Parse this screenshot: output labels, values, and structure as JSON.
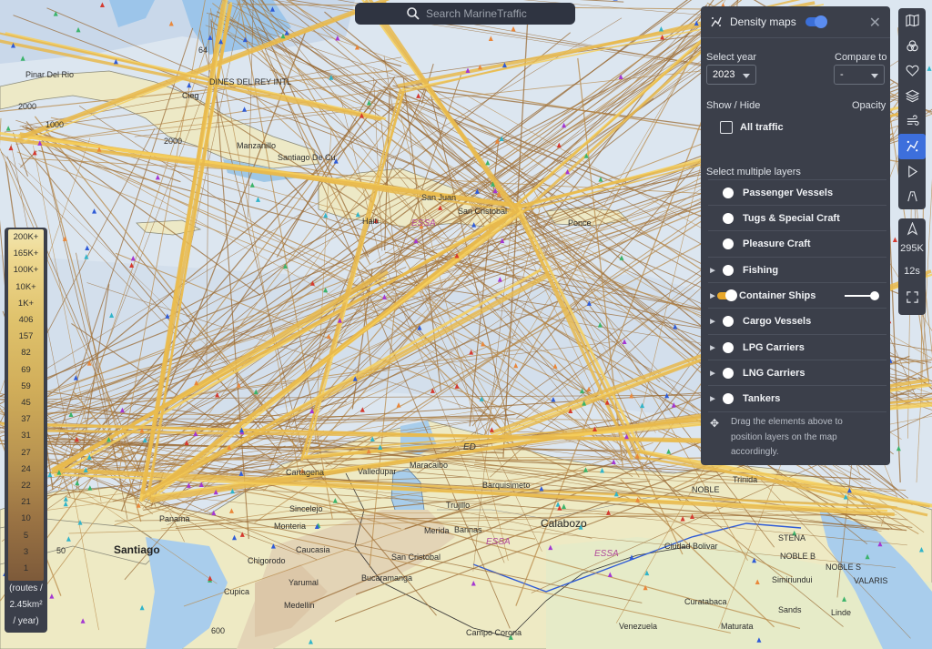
{
  "search": {
    "placeholder": "Search MarineTraffic"
  },
  "map_labels": {
    "pinar": "Pinar Del Rio",
    "jardines": "DINES DEL REY INTL",
    "manzanillo": "Manzanillo",
    "santiago_cuba": "Santiago De Cu",
    "cieg": "Cieg",
    "san_juan": "San Juan",
    "san_cristobal": "San Cristobal",
    "ponce": "Ponce",
    "haiti": "Haiti",
    "essa1": "ESSA",
    "maracaibo": "Maracaibo",
    "valledupar": "Valledupar",
    "cartagena": "Cartagena",
    "barquisimeto": "Barquisimeto",
    "trujillo": "Trujillo",
    "calabozo": "Calabozo",
    "merida": "Merida",
    "barinas": "Barinas",
    "essa2": "ESSA",
    "essa3": "ESSA",
    "san_cristobal2": "San Cristobal",
    "bucaramanga": "Bucaramanga",
    "sincelejo": "Sincelejo",
    "monteria": "Monteria",
    "caucasia": "Caucasia",
    "panama": "Panama",
    "santiago": "Santiago",
    "chigorodo": "Chigorodo",
    "yarumal": "Yarumal",
    "cupica": "Cupica",
    "medellin": "Medellin",
    "campo_corona": "Campo Corona",
    "venezuela": "Venezuela",
    "curatabaca": "Curatabaca",
    "maturata": "Maturata",
    "sands": "Sands",
    "linde": "Linde",
    "ciudad_bolivar": "Ciudad Bolivar",
    "simiriundui": "Simiriundui",
    "noble": "NOBLE",
    "trinidad": "Trinida",
    "stena": "STENA",
    "noble_b": "NOBLE B",
    "noble_s": "NOBLE S",
    "valaris": "VALARIS",
    "depth_2000a": "2000",
    "depth_2000b": "2000",
    "depth_1000": "1000",
    "depth_64": "64",
    "depth_600": "600",
    "depth_50": "50",
    "ed": "ED"
  },
  "panel": {
    "title": "Density maps",
    "year_label": "Select year",
    "year_value": "2023",
    "compare_label": "Compare to",
    "compare_value": "-",
    "show_hide": "Show / Hide",
    "opacity": "Opacity",
    "all_traffic": "All traffic",
    "multi_label": "Select multiple layers",
    "layers": [
      {
        "label": "Passenger Vessels"
      },
      {
        "label": "Tugs & Special Craft"
      },
      {
        "label": "Pleasure Craft"
      },
      {
        "label": "Fishing"
      },
      {
        "label": "Container Ships"
      },
      {
        "label": "Cargo Vessels"
      },
      {
        "label": "LPG Carriers"
      },
      {
        "label": "LNG Carriers"
      },
      {
        "label": "Tankers"
      }
    ],
    "hint": "Drag the elements above to position layers on the map accordingly."
  },
  "toolbar2": {
    "count": "295K",
    "interval": "12s"
  },
  "legend": {
    "values": [
      "200K+",
      "165K+",
      "100K+",
      "10K+",
      "1K+",
      "406",
      "157",
      "82",
      "69",
      "59",
      "45",
      "37",
      "31",
      "27",
      "24",
      "22",
      "21",
      "10",
      "5",
      "3",
      "1"
    ],
    "unit1": "(routes /",
    "unit2": "2.45km²",
    "unit3": "/ year)"
  },
  "colors": {
    "panel": "#3b3f4a",
    "accent": "#3d6fdc",
    "route": "#e8b84c",
    "sea": "#dbe6f1",
    "land": "#ece8c4"
  }
}
